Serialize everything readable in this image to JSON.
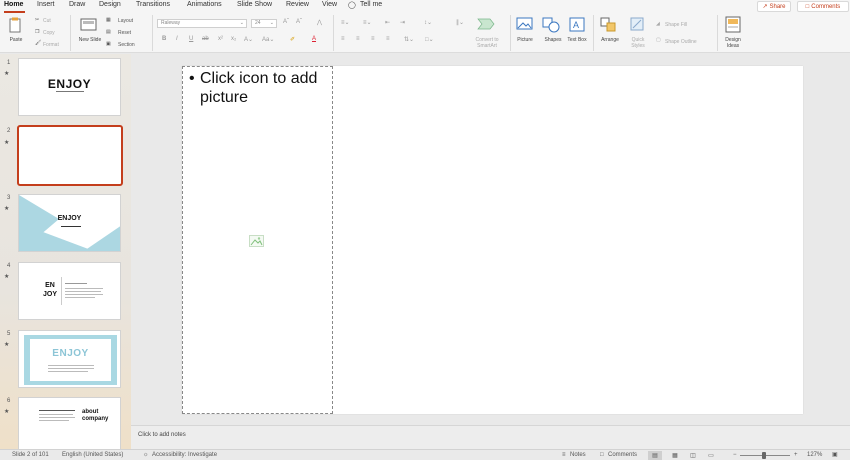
{
  "tabs": [
    {
      "label": "Home",
      "active": true
    },
    {
      "label": "Insert"
    },
    {
      "label": "Draw"
    },
    {
      "label": "Design"
    },
    {
      "label": "Transitions"
    },
    {
      "label": "Animations"
    },
    {
      "label": "Slide Show"
    },
    {
      "label": "Review"
    },
    {
      "label": "View"
    },
    {
      "label": "Tell me"
    }
  ],
  "header_actions": {
    "share": "Share",
    "comments": "Comments"
  },
  "ribbon": {
    "paste": "Paste",
    "cut": "Cut",
    "copy": "Copy",
    "format": "Format",
    "new_slide": "New Slide",
    "layout": "Layout",
    "reset": "Reset",
    "section": "Section",
    "font_name": "Raleway",
    "font_size": "24",
    "convert_smartart": "Convert to SmartArt",
    "picture": "Picture",
    "shapes": "Shapes",
    "text_box": "Text Box",
    "arrange": "Arrange",
    "quick_styles": "Quick Styles",
    "shape_fill": "Shape Fill",
    "shape_outline": "Shape Outline",
    "design_ideas": "Design Ideas"
  },
  "thumbnails": [
    {
      "number": "1",
      "title": "ENJOY"
    },
    {
      "number": "2",
      "title": ""
    },
    {
      "number": "3",
      "title": "ENJOY"
    },
    {
      "number": "4",
      "title": "EN JOY"
    },
    {
      "number": "5",
      "title": "ENJOY"
    },
    {
      "number": "6",
      "title": "about company"
    }
  ],
  "slide": {
    "bullet": "•",
    "placeholder_line1": "Click icon to add",
    "placeholder_line2": "picture"
  },
  "notes": {
    "placeholder": "Click to add notes"
  },
  "status": {
    "slide_counter": "Slide 2 of 101",
    "language": "English (United States)",
    "accessibility": "Accessibility: Investigate",
    "notes": "Notes",
    "comments": "Comments",
    "zoom": "127%"
  },
  "colors": {
    "accent": "#c43e1c",
    "thumb_blue": "#a9d8e3"
  }
}
